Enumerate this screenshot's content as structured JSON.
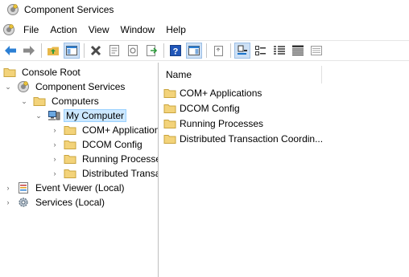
{
  "window": {
    "title": "Component Services"
  },
  "menu": {
    "items": [
      "File",
      "Action",
      "View",
      "Window",
      "Help"
    ]
  },
  "toolbar": {
    "buttons": [
      "back-arrow-icon",
      "forward-arrow-icon",
      "folder-up-icon",
      "show-hide-tree-icon",
      "delete-icon",
      "properties-icon",
      "refresh-icon",
      "export-list-icon",
      "help-icon",
      "show-hide-action-icon",
      "new-window-icon",
      "large-icons-view-icon",
      "small-icons-view-icon",
      "list-view-icon",
      "detail-view-icon",
      "configure-icon"
    ]
  },
  "tree": {
    "items": [
      {
        "label": "Console Root"
      },
      {
        "label": "Component Services"
      },
      {
        "label": "Computers"
      },
      {
        "label": "My Computer"
      },
      {
        "label": "COM+ Applications"
      },
      {
        "label": "DCOM Config"
      },
      {
        "label": "Running Processes"
      },
      {
        "label": "Distributed Transaction Coordinator"
      },
      {
        "label": "Event Viewer (Local)"
      },
      {
        "label": "Services (Local)"
      }
    ]
  },
  "list": {
    "header": "Name",
    "items": [
      {
        "label": "COM+ Applications"
      },
      {
        "label": "DCOM Config"
      },
      {
        "label": "Running Processes"
      },
      {
        "label": "Distributed Transaction Coordin..."
      }
    ]
  },
  "colors": {
    "folder": "#e8b84a",
    "selection": "#cce8ff",
    "accent": "#1a73c9"
  }
}
